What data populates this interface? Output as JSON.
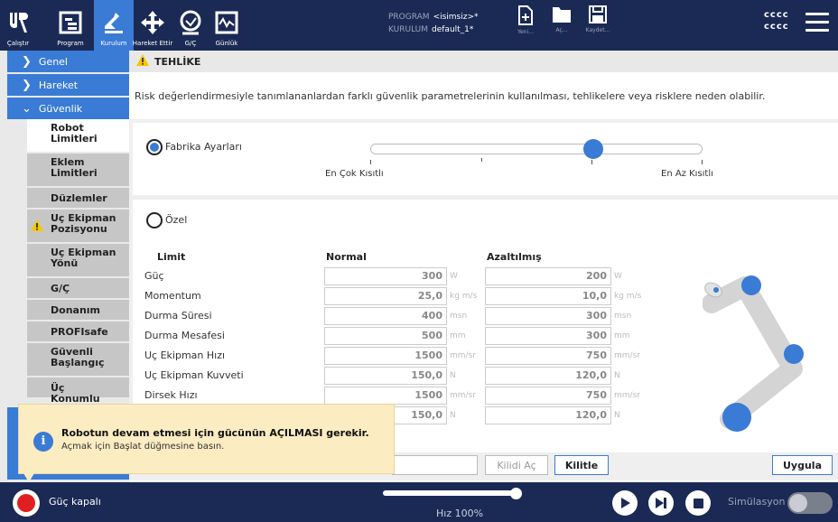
{
  "topbar": {
    "nav": [
      {
        "label": "Çalıştır",
        "icon": "ur-logo-icon"
      },
      {
        "label": "Program",
        "icon": "program-icon"
      },
      {
        "label": "Kurulum",
        "icon": "installation-icon"
      },
      {
        "label": "Hareket Ettir",
        "icon": "move-arrows-icon"
      },
      {
        "label": "G/Ç",
        "icon": "io-icon"
      },
      {
        "label": "Günlük",
        "icon": "log-icon"
      }
    ],
    "program_key": "PROGRAM",
    "program_value": "<isimsiz>*",
    "installation_key": "KURULUM",
    "installation_value": "default_1*",
    "file": {
      "new": "Yeni...",
      "open": "Aç...",
      "save": "Kaydet..."
    },
    "user": [
      "cccc",
      "cccc"
    ]
  },
  "sidebar": {
    "sections": [
      "Genel",
      "Hareket",
      "Güvenlik"
    ],
    "items": [
      "Robot Limitleri",
      "Eklem Limitleri",
      "Düzlemler",
      "Uç Ekipman Pozisyonu",
      "Uç Ekipman Yönü",
      "G/Ç",
      "Donanım",
      "PROFIsafe",
      "Güvenli Başlangıç",
      "Üç Konumlu"
    ]
  },
  "main": {
    "header": "TEHLİKE",
    "description": "Risk değerlendirmesiyle tanımlananlardan farklı güvenlik parametrelerinin kullanılması, tehlikelere veya risklere neden olabilir.",
    "factory_label": "Fabrika Ayarları",
    "slider_min_label": "En Çok Kısıtlı",
    "slider_max_label": "En Az Kısıtlı",
    "slider_level": 0.67,
    "custom_label": "Özel",
    "col_limit": "Limit",
    "col_normal": "Normal",
    "col_reduced": "Azaltılmış",
    "rows": [
      {
        "name": "Güç",
        "normal": "300",
        "reduced": "200",
        "unit": "W"
      },
      {
        "name": "Momentum",
        "normal": "25,0",
        "reduced": "10,0",
        "unit": "kg m/s"
      },
      {
        "name": "Durma Süresi",
        "normal": "400",
        "reduced": "300",
        "unit": "msn"
      },
      {
        "name": "Durma Mesafesi",
        "normal": "500",
        "reduced": "300",
        "unit": "mm"
      },
      {
        "name": "Uç Ekipman Hızı",
        "normal": "1500",
        "reduced": "750",
        "unit": "mm/sr"
      },
      {
        "name": "Uç Ekipman Kuvveti",
        "normal": "150,0",
        "reduced": "120,0",
        "unit": "N"
      },
      {
        "name": "Dirsek Hızı",
        "normal": "1500",
        "reduced": "750",
        "unit": "mm/sr"
      },
      {
        "name": "",
        "normal": "150,0",
        "reduced": "120,0",
        "unit": "N"
      }
    ],
    "unlock": "Kilidi Aç",
    "lock": "Kilitle",
    "apply": "Uygula"
  },
  "toast": {
    "title": "Robotun devam etmesi için gücünün AÇILMASI gerekir.",
    "body": "Açmak için Başlat düğmesine basın.",
    "icon": "info-icon"
  },
  "bottombar": {
    "power": "Güç kapalı",
    "speed": "Hız 100%",
    "speed_level": 1.0,
    "simulation": "Simülasyon"
  }
}
